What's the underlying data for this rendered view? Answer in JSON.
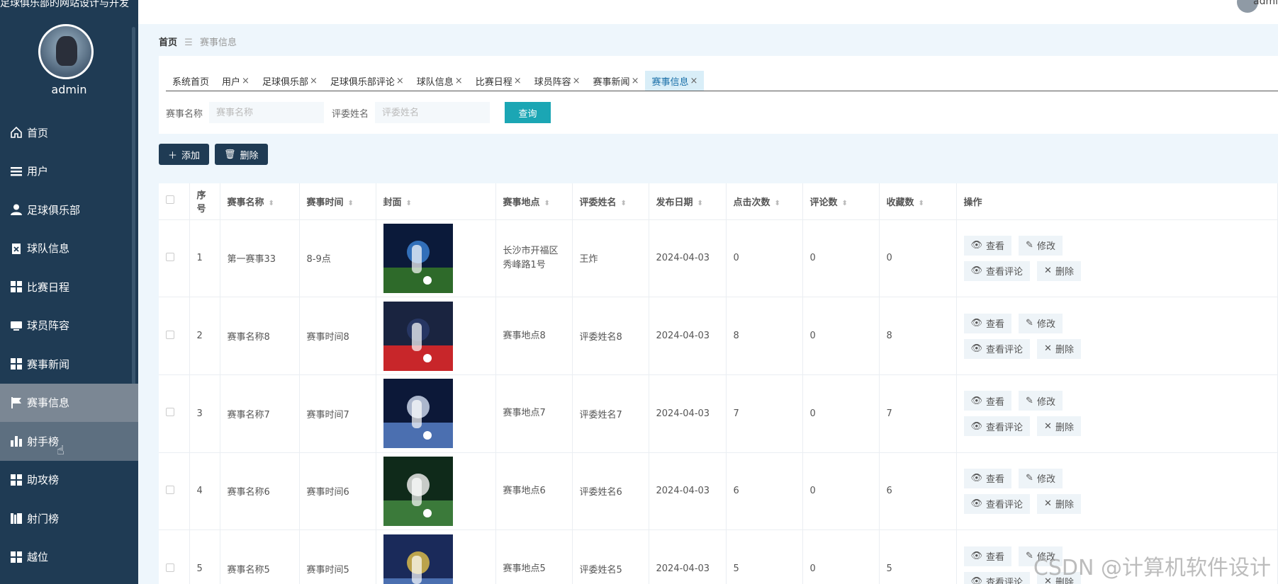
{
  "sidebar": {
    "site_title": "足球俱乐部的网站设计与开发",
    "username": "admin",
    "items": [
      {
        "label": "首页",
        "icon": "home-icon"
      },
      {
        "label": "用户",
        "icon": "list-icon"
      },
      {
        "label": "足球俱乐部",
        "icon": "user-icon"
      },
      {
        "label": "球队信息",
        "icon": "clipboard-icon"
      },
      {
        "label": "比赛日程",
        "icon": "grid-icon"
      },
      {
        "label": "球员阵容",
        "icon": "monitor-icon"
      },
      {
        "label": "赛事新闻",
        "icon": "grid-icon"
      },
      {
        "label": "赛事信息",
        "icon": "flag-icon"
      },
      {
        "label": "射手榜",
        "icon": "bar-chart-icon"
      },
      {
        "label": "助攻榜",
        "icon": "grid-icon"
      },
      {
        "label": "射门榜",
        "icon": "books-icon"
      },
      {
        "label": "越位",
        "icon": "grid-icon"
      }
    ]
  },
  "topbar": {
    "user": "admi"
  },
  "breadcrumb": {
    "home": "首页",
    "current": "赛事信息"
  },
  "tabs": [
    {
      "label": "系统首页"
    },
    {
      "label": "用户"
    },
    {
      "label": "足球俱乐部"
    },
    {
      "label": "足球俱乐部评论"
    },
    {
      "label": "球队信息"
    },
    {
      "label": "比赛日程"
    },
    {
      "label": "球员阵容"
    },
    {
      "label": "赛事新闻"
    },
    {
      "label": "赛事信息"
    }
  ],
  "search": {
    "name_label": "赛事名称",
    "name_placeholder": "赛事名称",
    "judge_label": "评委姓名",
    "judge_placeholder": "评委姓名",
    "query_button": "查询"
  },
  "actions": {
    "add": "添加",
    "delete": "删除"
  },
  "table": {
    "headers": [
      "序号",
      "赛事名称",
      "赛事时间",
      "封面",
      "赛事地点",
      "评委姓名",
      "发布日期",
      "点击次数",
      "评论数",
      "收藏数",
      "操作"
    ],
    "op_labels": {
      "view": "查看",
      "edit": "修改",
      "comments": "查看评论",
      "delete": "删除"
    },
    "rows": [
      {
        "idx": "1",
        "name": "第一赛事33",
        "time": "8-9点",
        "place": "长沙市开福区秀峰路1号",
        "judge": "王炸",
        "date": "2024-04-03",
        "clicks": "0",
        "comments": "0",
        "favs": "0"
      },
      {
        "idx": "2",
        "name": "赛事名称8",
        "time": "赛事时间8",
        "place": "赛事地点8",
        "judge": "评委姓名8",
        "date": "2024-04-03",
        "clicks": "8",
        "comments": "0",
        "favs": "8"
      },
      {
        "idx": "3",
        "name": "赛事名称7",
        "time": "赛事时间7",
        "place": "赛事地点7",
        "judge": "评委姓名7",
        "date": "2024-04-03",
        "clicks": "7",
        "comments": "0",
        "favs": "7"
      },
      {
        "idx": "4",
        "name": "赛事名称6",
        "time": "赛事时间6",
        "place": "赛事地点6",
        "judge": "评委姓名6",
        "date": "2024-04-03",
        "clicks": "6",
        "comments": "0",
        "favs": "6"
      },
      {
        "idx": "5",
        "name": "赛事名称5",
        "time": "赛事时间5",
        "place": "赛事地点5",
        "judge": "评委姓名5",
        "date": "2024-04-03",
        "clicks": "5",
        "comments": "0",
        "favs": "5"
      }
    ]
  },
  "watermark": "CSDN @计算机软件设计"
}
